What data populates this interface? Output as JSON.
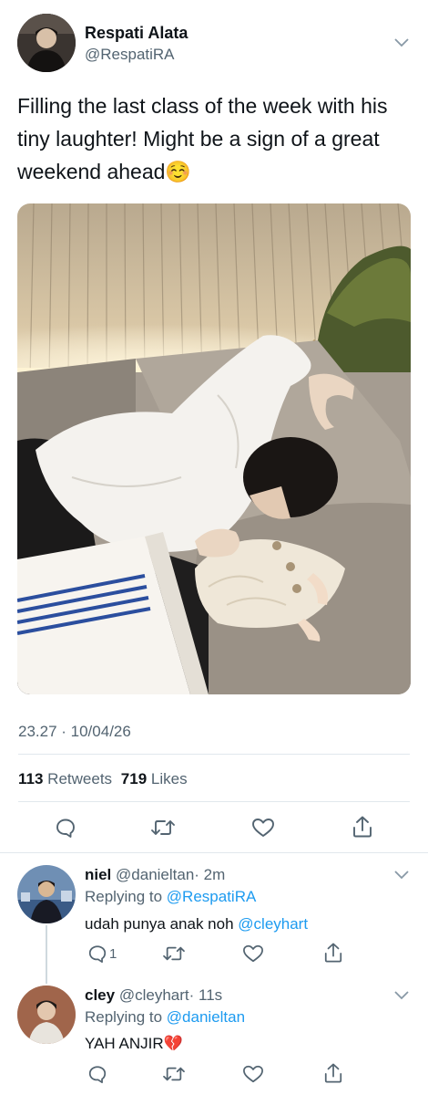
{
  "tweet": {
    "author_name": "Respati Alata",
    "author_handle": "@RespatiRA",
    "text": "Filling the last class of the week with his tiny laughter! Might be a sign of a great weekend ahead",
    "emoji": "☺️",
    "timestamp": "23.27 · 10/04/26",
    "retweet_count": "113",
    "retweet_label": "Retweets",
    "like_count": "719",
    "like_label": "Likes"
  },
  "replies": [
    {
      "name": "niel",
      "handle": "@danieltan",
      "time": "· 2m",
      "replying_prefix": "Replying to",
      "replying_to": "@RespatiRA",
      "text": "udah punya anak noh",
      "mention": "@cleyhart",
      "reply_count": "1"
    },
    {
      "name": "cley",
      "handle": "@cleyhart",
      "time": "· 11s",
      "replying_prefix": "Replying to",
      "replying_to": "@danieltan",
      "text": "YAH ANJIR",
      "emoji": "💔"
    }
  ],
  "colors": {
    "accent": "#1d9bf0",
    "muted": "#536471",
    "divider": "#e1e8ed"
  }
}
